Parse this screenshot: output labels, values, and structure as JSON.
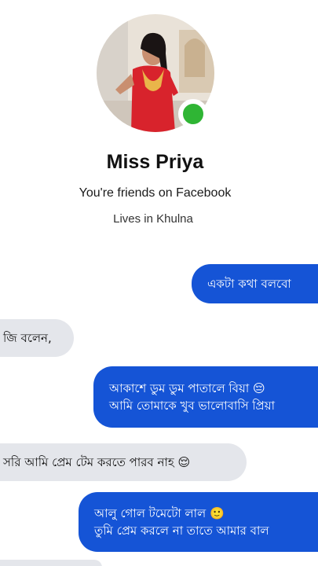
{
  "profile": {
    "name": "Miss Priya",
    "friends_text": "You're friends on Facebook",
    "location_text": "Lives in Khulna",
    "online_status_color": "#2fb534"
  },
  "messages": [
    {
      "direction": "outgoing",
      "lines": [
        "একটা কথা বলবো"
      ]
    },
    {
      "direction": "incoming",
      "lines": [
        "জি বলেন,"
      ]
    },
    {
      "direction": "outgoing",
      "lines": [
        "আকাশে ডুম ডুম পাতালে বিয়া 😔",
        "আমি তোমাকে খুব ভালোবাসি প্রিয়া"
      ]
    },
    {
      "direction": "incoming",
      "lines": [
        "সরি আমি প্রেম টেম করতে পারব নাহ 😌"
      ]
    },
    {
      "direction": "outgoing",
      "lines": [
        "আলু গোল টমেটো লাল 🙂",
        "তুমি প্রেম করলে না তাতে আমার বাল"
      ]
    }
  ],
  "colors": {
    "outgoing_bubble": "#1554d6",
    "incoming_bubble": "#e4e6eb"
  }
}
